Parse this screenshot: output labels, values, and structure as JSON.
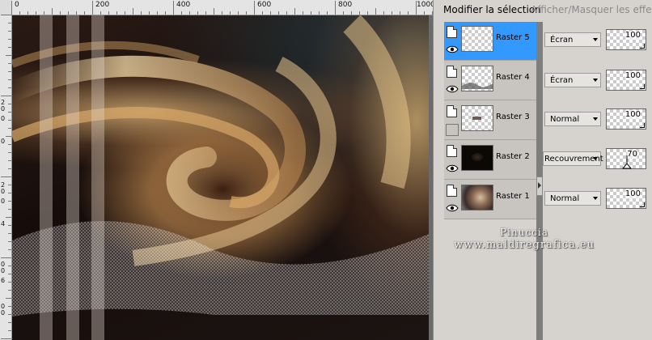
{
  "colors": {
    "panel_background": "#d6d3ce",
    "selected_layer": "#3399ff",
    "canvas_background": "#6b6b6b",
    "ruler": "#e4e4e4"
  },
  "rulers": {
    "top_labels": [
      "0",
      "200",
      "400",
      "600",
      "800",
      "1000"
    ],
    "left_labels": [
      "2",
      "0",
      "0",
      "0",
      "2",
      "0",
      "0",
      "4",
      "0",
      "0",
      "6",
      "0",
      "0"
    ]
  },
  "panel_header": {
    "modify_selection": "Modifier la sélection",
    "toggle_mask_effects": "Afficher/Masquer les effets de"
  },
  "layers": [
    {
      "name": "Raster 5",
      "visible": true,
      "selected": true,
      "thumbnail": "transparent",
      "blend_mode": "Écran",
      "opacity": "100"
    },
    {
      "name": "Raster 4",
      "visible": true,
      "selected": false,
      "thumbnail": "wave-pattern",
      "blend_mode": "Écran",
      "opacity": "100"
    },
    {
      "name": "Raster 3",
      "visible": false,
      "selected": false,
      "thumbnail": "small-bar",
      "blend_mode": "Normal",
      "opacity": "100"
    },
    {
      "name": "Raster 2",
      "visible": true,
      "selected": false,
      "thumbnail": "dark-glow",
      "blend_mode": "Recouvrement",
      "opacity": "70"
    },
    {
      "name": "Raster 1",
      "visible": true,
      "selected": false,
      "thumbnail": "swirl",
      "blend_mode": "Normal",
      "opacity": "100"
    }
  ],
  "icons": {
    "layer_type": "document-icon",
    "visibility": "eye-icon",
    "dropdown": "chevron-down-icon"
  },
  "watermark": {
    "line1": "Pinuccia",
    "line2": "www.maldiregrafica.eu"
  }
}
